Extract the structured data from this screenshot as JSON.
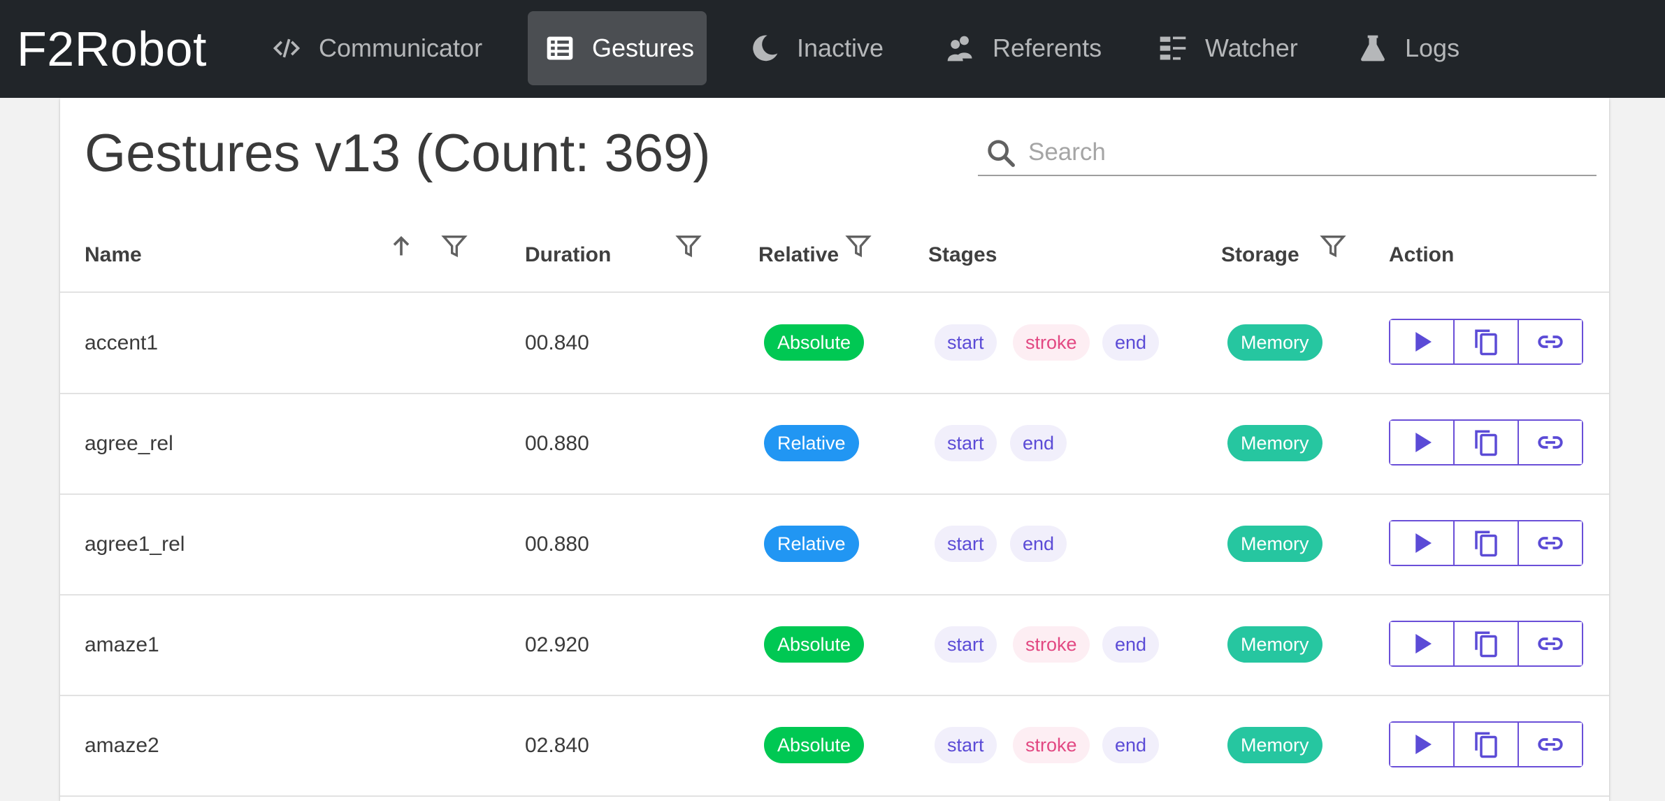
{
  "app": {
    "brand": "F2Robot"
  },
  "nav": [
    {
      "label": "Communicator",
      "icon": "code-icon",
      "active": false
    },
    {
      "label": "Gestures",
      "icon": "table-icon",
      "active": true
    },
    {
      "label": "Inactive",
      "icon": "moon-icon",
      "active": false
    },
    {
      "label": "Referents",
      "icon": "people-icon",
      "active": false
    },
    {
      "label": "Watcher",
      "icon": "list-icon",
      "active": false
    },
    {
      "label": "Logs",
      "icon": "flask-icon",
      "active": false
    }
  ],
  "page": {
    "title": "Gestures v13 (Count: 369)",
    "search_placeholder": "Search",
    "search_value": ""
  },
  "table": {
    "columns": {
      "name": "Name",
      "duration": "Duration",
      "relative": "Relative",
      "stages": "Stages",
      "storage": "Storage",
      "action": "Action"
    },
    "rows": [
      {
        "name": "accent1",
        "duration": "00.840",
        "relative": "Absolute",
        "stages": [
          "start",
          "stroke",
          "end"
        ],
        "storage": "Memory"
      },
      {
        "name": "agree_rel",
        "duration": "00.880",
        "relative": "Relative",
        "stages": [
          "start",
          "end"
        ],
        "storage": "Memory"
      },
      {
        "name": "agree1_rel",
        "duration": "00.880",
        "relative": "Relative",
        "stages": [
          "start",
          "end"
        ],
        "storage": "Memory"
      },
      {
        "name": "amaze1",
        "duration": "02.920",
        "relative": "Absolute",
        "stages": [
          "start",
          "stroke",
          "end"
        ],
        "storage": "Memory"
      },
      {
        "name": "amaze2",
        "duration": "02.840",
        "relative": "Absolute",
        "stages": [
          "start",
          "stroke",
          "end"
        ],
        "storage": "Memory"
      }
    ]
  },
  "colors": {
    "navbar": "#212529",
    "absolute": "#00c853",
    "relative": "#2196f3",
    "memory": "#26c6a0",
    "action_border": "#6a4fd8"
  }
}
